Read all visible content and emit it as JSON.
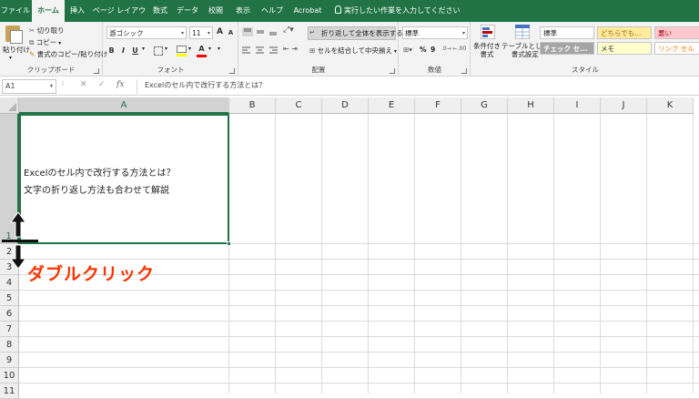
{
  "tabs": [
    {
      "label": "ファイル",
      "active": false
    },
    {
      "label": "ホーム",
      "active": true
    },
    {
      "label": "挿入",
      "active": false
    },
    {
      "label": "ページ レイアウト",
      "active": false
    },
    {
      "label": "数式",
      "active": false
    },
    {
      "label": "データ",
      "active": false
    },
    {
      "label": "校閲",
      "active": false
    },
    {
      "label": "表示",
      "active": false
    },
    {
      "label": "ヘルプ",
      "active": false
    },
    {
      "label": "Acrobat",
      "active": false
    }
  ],
  "tell_me": "実行したい作業を入力してください",
  "ribbon": {
    "clipboard": {
      "paste": "貼り付け",
      "cut": "切り取り",
      "copy": "コピー",
      "format_painter": "書式のコピー/貼り付け",
      "group_label": "クリップボード"
    },
    "font": {
      "font_name": "游ゴシック",
      "font_size": "11",
      "bold": "B",
      "italic": "I",
      "underline": "U",
      "grow": "A",
      "shrink": "A",
      "font_color_glyph": "A",
      "group_label": "フォント"
    },
    "alignment": {
      "wrap_text": "折り返して全体を表示する",
      "merge_center": "セルを結合して中央揃え",
      "group_label": "配置"
    },
    "number": {
      "format": "標準",
      "percent": "%",
      "comma": "9",
      "group_label": "数値"
    },
    "styles": {
      "conditional": "条件付き\n書式",
      "table": "テーブルとして\n書式設定",
      "cells": [
        {
          "label": "標準",
          "bg": "#ffffff",
          "color": "#222222"
        },
        {
          "label": "どちらでも...",
          "bg": "#ffeb9c",
          "color": "#9c6500"
        },
        {
          "label": "悪い",
          "bg": "#ffc7ce",
          "color": "#9c0006"
        },
        {
          "label": "チェック セ...",
          "bg": "#a5a5a5",
          "color": "#ffffff"
        },
        {
          "label": "メモ",
          "bg": "#ffffcc",
          "color": "#222222"
        },
        {
          "label": "リンク セル",
          "bg": "#ffffff",
          "color": "#fa7d00"
        }
      ],
      "group_label": "スタイル"
    }
  },
  "formula_bar": {
    "name_box": "A1",
    "cancel": "✕",
    "enter": "✓",
    "fx": "fx",
    "content": "Excelのセル内で改行する方法とは？"
  },
  "sheet": {
    "columns": [
      "A",
      "B",
      "C",
      "D",
      "E",
      "F",
      "G",
      "H",
      "I",
      "J",
      "K"
    ],
    "rows": [
      "1",
      "2",
      "3",
      "4",
      "5",
      "6",
      "7",
      "8",
      "9",
      "10",
      "11"
    ],
    "cell_a1_lines": [
      "Excelのセル内で改行する方法とは？",
      "文字の折り返し方法も合わせて解説"
    ]
  },
  "annotation": "ダブルクリック",
  "colors": {
    "accent": "#217346",
    "annotation": "#ff3300"
  }
}
